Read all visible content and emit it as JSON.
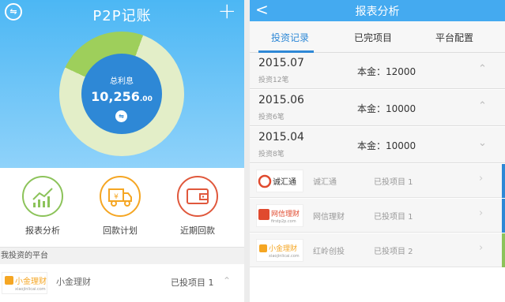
{
  "left": {
    "title": "P2P记账",
    "menu_icon_glyph": "⇋",
    "add_glyph": "+",
    "summary": {
      "label": "总利息",
      "value_int": "10,256",
      "value_dec": ".00",
      "icon_glyph": "⇋"
    },
    "features": [
      {
        "label": "报表分析",
        "color": "#8cc35a"
      },
      {
        "label": "回款计划",
        "color": "#f5a623"
      },
      {
        "label": "近期回款",
        "color": "#e0583c"
      }
    ],
    "section_title": "我投资的平台",
    "platform": {
      "logo_text": "小金理财",
      "logo_sub": "xiaojinlicai.com",
      "name": "小金理财",
      "count": "已投项目  1",
      "chevron": "⌃"
    }
  },
  "right": {
    "title": "报表分析",
    "back_glyph": "<",
    "tabs": [
      "投资记录",
      "已完项目",
      "平台配置"
    ],
    "records": [
      {
        "date": "2015.07",
        "count": "投资12笔",
        "principal": "本金：12000",
        "chevron": "⌃"
      },
      {
        "date": "2015.06",
        "count": "投资6笔",
        "principal": "本金：10000",
        "chevron": "⌃"
      },
      {
        "date": "2015.04",
        "count": "投资8笔",
        "principal": "本金：10000",
        "chevron": "⌄"
      }
    ],
    "platforms": [
      {
        "logo_text": "诚汇通",
        "name": "诚汇通",
        "count": "已投项目  1",
        "bar": "#2e88d6"
      },
      {
        "logo_text": "网信理财",
        "logo_sub": "firstp2p.com",
        "name": "网信理财",
        "count": "已投项目  1",
        "bar": "#2e88d6"
      },
      {
        "logo_text": "小金理财",
        "logo_sub": "xiaojinlicai.com",
        "name": "红岭创投",
        "count": "已投项目  2",
        "bar": "#8cc35a"
      }
    ],
    "row_chevron": "›"
  }
}
